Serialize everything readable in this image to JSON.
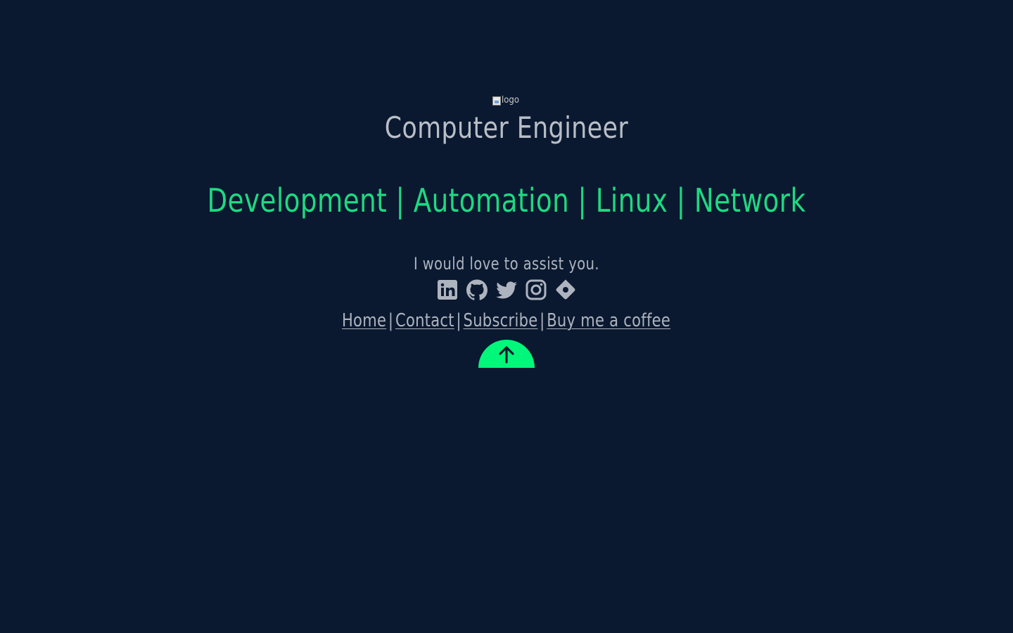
{
  "logo": {
    "alt": "logo"
  },
  "hero": {
    "title": "Computer Engineer",
    "skills": "Development | Automation | Linux | Network"
  },
  "tagline": "I would love to assist you.",
  "social": [
    {
      "name": "linkedin",
      "icon": "linkedin-icon"
    },
    {
      "name": "github",
      "icon": "github-icon"
    },
    {
      "name": "twitter",
      "icon": "twitter-icon"
    },
    {
      "name": "instagram",
      "icon": "instagram-icon"
    },
    {
      "name": "location",
      "icon": "map-pin-icon"
    }
  ],
  "footer": {
    "home": "Home",
    "contact": "Contact",
    "subscribe": "Subscribe",
    "coffee": "Buy me a coffee",
    "separator": "|"
  },
  "colors": {
    "background": "#0a1930",
    "accent": "#1ed981",
    "button": "#00f77a",
    "text": "#aeb4bf"
  }
}
